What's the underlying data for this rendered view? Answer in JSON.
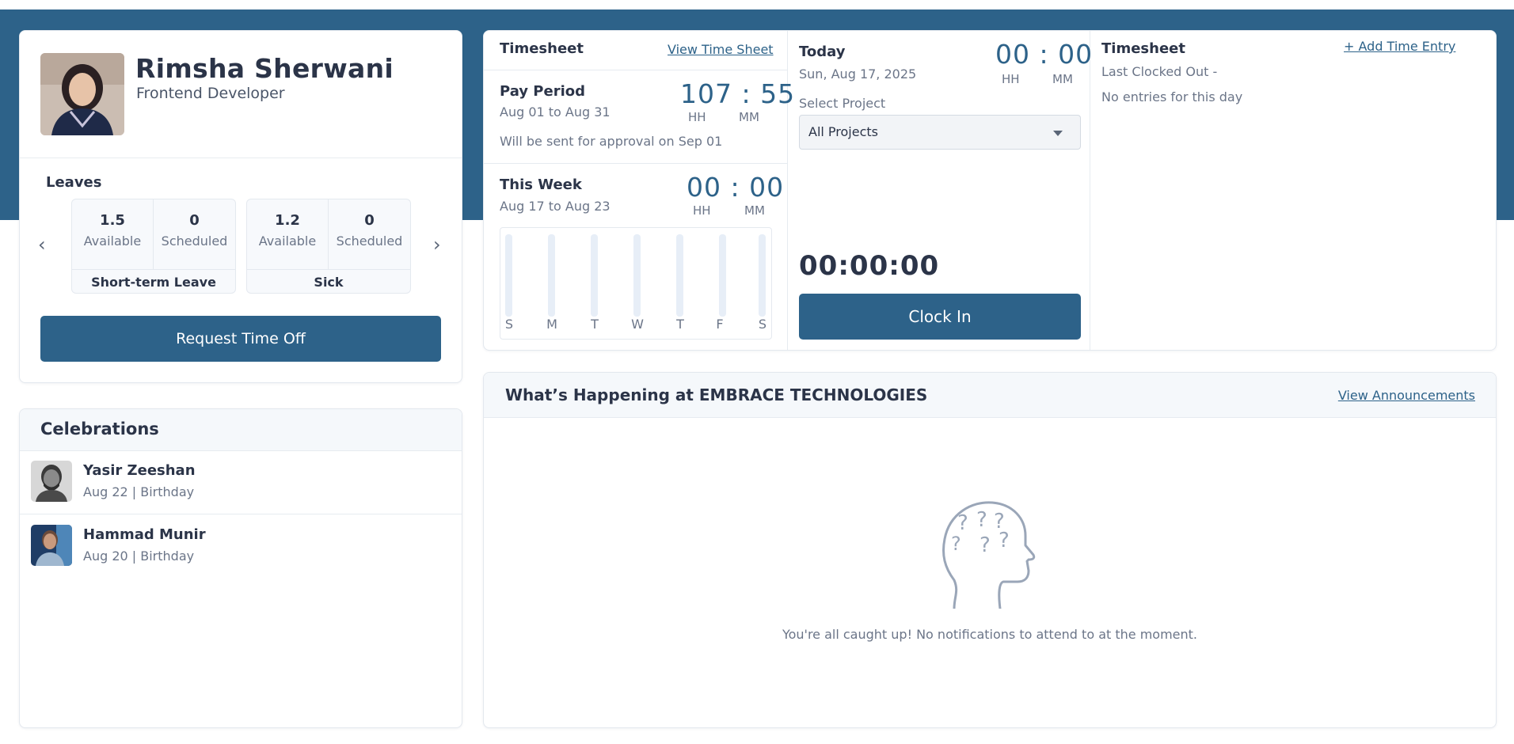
{
  "colors": {
    "brand": "#2d6289",
    "text": "#2b3448",
    "muted": "#6b7588",
    "border": "#e6ebf0"
  },
  "profile": {
    "name": "Rimsha Sherwani",
    "role": "Frontend Developer",
    "leaves": {
      "title": "Leaves",
      "types": [
        {
          "available": "1.5",
          "available_label": "Available",
          "scheduled": "0",
          "scheduled_label": "Scheduled",
          "name": "Short-term Leave"
        },
        {
          "available": "1.2",
          "available_label": "Available",
          "scheduled": "0",
          "scheduled_label": "Scheduled",
          "name": "Sick"
        }
      ],
      "prev_icon": "‹",
      "next_icon": "›"
    },
    "request_button": "Request Time Off"
  },
  "celebrations": {
    "title": "Celebrations",
    "items": [
      {
        "name": "Yasir Zeeshan",
        "detail": "Aug 22 | Birthday"
      },
      {
        "name": "Hammad Munir",
        "detail": "Aug 20 | Birthday"
      }
    ]
  },
  "timesheet": {
    "title": "Timesheet",
    "view_link": "View Time Sheet",
    "pay_period": {
      "title": "Pay Period",
      "range": "Aug 01 to Aug 31",
      "time": "107 : 55",
      "hh": "HH",
      "mm": "MM",
      "note": "Will be sent for approval on Sep 01"
    },
    "this_week": {
      "title": "This Week",
      "range": "Aug 17 to Aug 23",
      "time": "00 : 00",
      "hh": "HH",
      "mm": "MM",
      "days": [
        "S",
        "M",
        "T",
        "W",
        "T",
        "F",
        "S"
      ]
    },
    "today": {
      "title": "Today",
      "date": "Sun, Aug 17, 2025",
      "time": "00 : 00",
      "hh": "HH",
      "mm": "MM",
      "select_label": "Select Project",
      "select_value": "All Projects",
      "clock": "00:00:00",
      "clock_button": "Clock In"
    },
    "entries": {
      "title": "Timesheet",
      "add_link": "+ Add Time Entry",
      "last_clocked": "Last Clocked Out -",
      "empty": "No entries for this day"
    }
  },
  "announcements": {
    "title": "What’s Happening at EMBRACE TECHNOLOGIES",
    "link": "View Announcements",
    "empty_text": "You're all caught up! No notifications to attend to at the moment."
  }
}
